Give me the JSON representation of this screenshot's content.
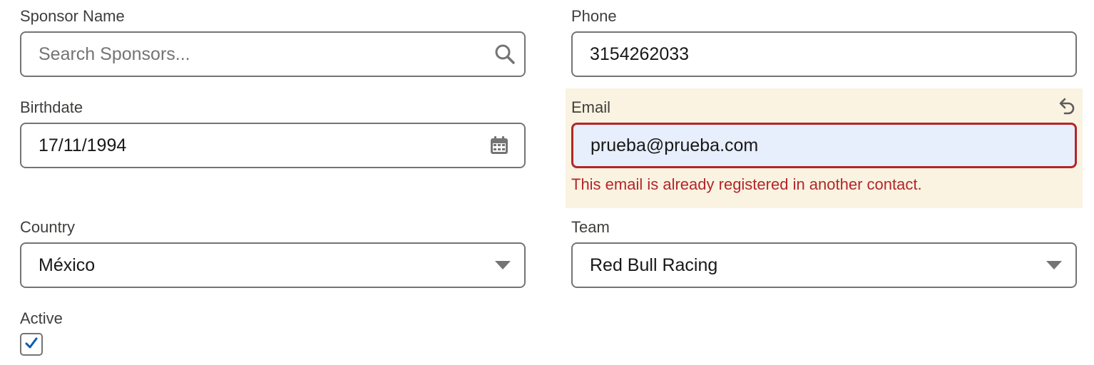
{
  "fields": {
    "sponsor_name": {
      "label": "Sponsor Name",
      "placeholder": "Search Sponsors...",
      "value": "",
      "icon": "search-icon"
    },
    "phone": {
      "label": "Phone",
      "value": "3154262033"
    },
    "birthdate": {
      "label": "Birthdate",
      "value": "17/11/1994",
      "icon": "calendar-icon"
    },
    "email": {
      "label": "Email",
      "value": "prueba@prueba.com",
      "error": "This email is already registered in another contact.",
      "undo_icon": "undo-icon"
    },
    "country": {
      "label": "Country",
      "value": "México",
      "icon": "chevron-down-icon"
    },
    "team": {
      "label": "Team",
      "value": "Red Bull Racing",
      "icon": "chevron-down-icon"
    },
    "active": {
      "label": "Active",
      "checked": true,
      "icon": "checkmark-icon"
    }
  },
  "colors": {
    "label": "#3e3e3c",
    "border": "#747474",
    "error": "#b3262a",
    "highlight_bg": "#faf3e1",
    "focused_input_bg": "#e7eefc",
    "check_blue": "#0b5cab"
  }
}
